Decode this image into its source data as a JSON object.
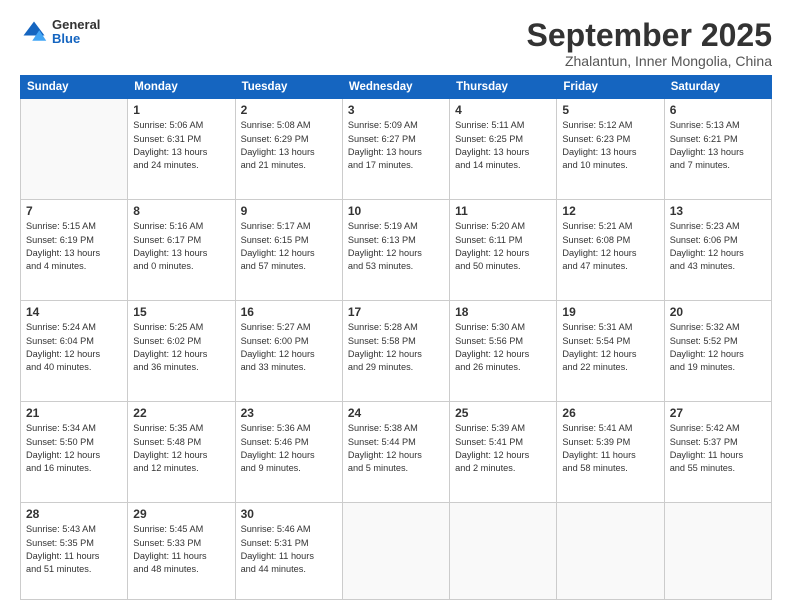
{
  "logo": {
    "general": "General",
    "blue": "Blue"
  },
  "title": "September 2025",
  "subtitle": "Zhalantun, Inner Mongolia, China",
  "headers": [
    "Sunday",
    "Monday",
    "Tuesday",
    "Wednesday",
    "Thursday",
    "Friday",
    "Saturday"
  ],
  "weeks": [
    [
      {
        "day": "",
        "info": ""
      },
      {
        "day": "1",
        "info": "Sunrise: 5:06 AM\nSunset: 6:31 PM\nDaylight: 13 hours\nand 24 minutes."
      },
      {
        "day": "2",
        "info": "Sunrise: 5:08 AM\nSunset: 6:29 PM\nDaylight: 13 hours\nand 21 minutes."
      },
      {
        "day": "3",
        "info": "Sunrise: 5:09 AM\nSunset: 6:27 PM\nDaylight: 13 hours\nand 17 minutes."
      },
      {
        "day": "4",
        "info": "Sunrise: 5:11 AM\nSunset: 6:25 PM\nDaylight: 13 hours\nand 14 minutes."
      },
      {
        "day": "5",
        "info": "Sunrise: 5:12 AM\nSunset: 6:23 PM\nDaylight: 13 hours\nand 10 minutes."
      },
      {
        "day": "6",
        "info": "Sunrise: 5:13 AM\nSunset: 6:21 PM\nDaylight: 13 hours\nand 7 minutes."
      }
    ],
    [
      {
        "day": "7",
        "info": "Sunrise: 5:15 AM\nSunset: 6:19 PM\nDaylight: 13 hours\nand 4 minutes."
      },
      {
        "day": "8",
        "info": "Sunrise: 5:16 AM\nSunset: 6:17 PM\nDaylight: 13 hours\nand 0 minutes."
      },
      {
        "day": "9",
        "info": "Sunrise: 5:17 AM\nSunset: 6:15 PM\nDaylight: 12 hours\nand 57 minutes."
      },
      {
        "day": "10",
        "info": "Sunrise: 5:19 AM\nSunset: 6:13 PM\nDaylight: 12 hours\nand 53 minutes."
      },
      {
        "day": "11",
        "info": "Sunrise: 5:20 AM\nSunset: 6:11 PM\nDaylight: 12 hours\nand 50 minutes."
      },
      {
        "day": "12",
        "info": "Sunrise: 5:21 AM\nSunset: 6:08 PM\nDaylight: 12 hours\nand 47 minutes."
      },
      {
        "day": "13",
        "info": "Sunrise: 5:23 AM\nSunset: 6:06 PM\nDaylight: 12 hours\nand 43 minutes."
      }
    ],
    [
      {
        "day": "14",
        "info": "Sunrise: 5:24 AM\nSunset: 6:04 PM\nDaylight: 12 hours\nand 40 minutes."
      },
      {
        "day": "15",
        "info": "Sunrise: 5:25 AM\nSunset: 6:02 PM\nDaylight: 12 hours\nand 36 minutes."
      },
      {
        "day": "16",
        "info": "Sunrise: 5:27 AM\nSunset: 6:00 PM\nDaylight: 12 hours\nand 33 minutes."
      },
      {
        "day": "17",
        "info": "Sunrise: 5:28 AM\nSunset: 5:58 PM\nDaylight: 12 hours\nand 29 minutes."
      },
      {
        "day": "18",
        "info": "Sunrise: 5:30 AM\nSunset: 5:56 PM\nDaylight: 12 hours\nand 26 minutes."
      },
      {
        "day": "19",
        "info": "Sunrise: 5:31 AM\nSunset: 5:54 PM\nDaylight: 12 hours\nand 22 minutes."
      },
      {
        "day": "20",
        "info": "Sunrise: 5:32 AM\nSunset: 5:52 PM\nDaylight: 12 hours\nand 19 minutes."
      }
    ],
    [
      {
        "day": "21",
        "info": "Sunrise: 5:34 AM\nSunset: 5:50 PM\nDaylight: 12 hours\nand 16 minutes."
      },
      {
        "day": "22",
        "info": "Sunrise: 5:35 AM\nSunset: 5:48 PM\nDaylight: 12 hours\nand 12 minutes."
      },
      {
        "day": "23",
        "info": "Sunrise: 5:36 AM\nSunset: 5:46 PM\nDaylight: 12 hours\nand 9 minutes."
      },
      {
        "day": "24",
        "info": "Sunrise: 5:38 AM\nSunset: 5:44 PM\nDaylight: 12 hours\nand 5 minutes."
      },
      {
        "day": "25",
        "info": "Sunrise: 5:39 AM\nSunset: 5:41 PM\nDaylight: 12 hours\nand 2 minutes."
      },
      {
        "day": "26",
        "info": "Sunrise: 5:41 AM\nSunset: 5:39 PM\nDaylight: 11 hours\nand 58 minutes."
      },
      {
        "day": "27",
        "info": "Sunrise: 5:42 AM\nSunset: 5:37 PM\nDaylight: 11 hours\nand 55 minutes."
      }
    ],
    [
      {
        "day": "28",
        "info": "Sunrise: 5:43 AM\nSunset: 5:35 PM\nDaylight: 11 hours\nand 51 minutes."
      },
      {
        "day": "29",
        "info": "Sunrise: 5:45 AM\nSunset: 5:33 PM\nDaylight: 11 hours\nand 48 minutes."
      },
      {
        "day": "30",
        "info": "Sunrise: 5:46 AM\nSunset: 5:31 PM\nDaylight: 11 hours\nand 44 minutes."
      },
      {
        "day": "",
        "info": ""
      },
      {
        "day": "",
        "info": ""
      },
      {
        "day": "",
        "info": ""
      },
      {
        "day": "",
        "info": ""
      }
    ]
  ]
}
